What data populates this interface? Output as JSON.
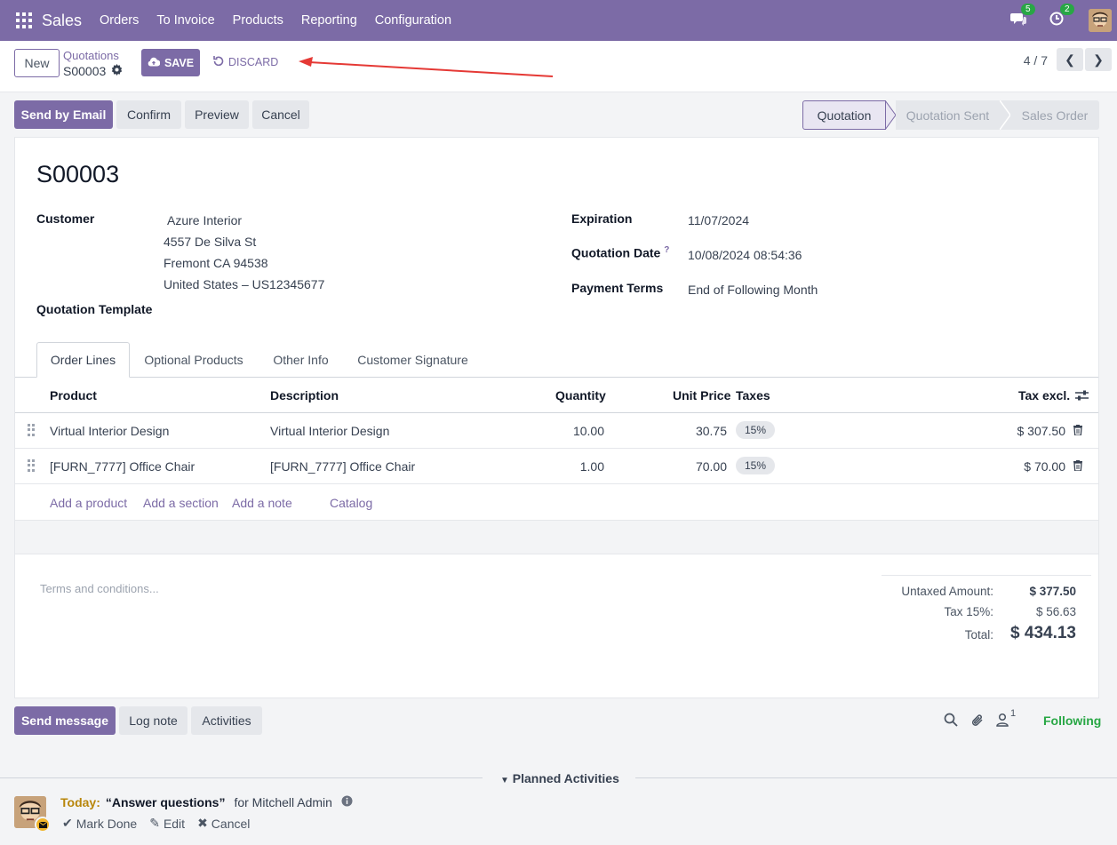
{
  "nav": {
    "app_name": "Sales",
    "menu": [
      "Orders",
      "To Invoice",
      "Products",
      "Reporting",
      "Configuration"
    ],
    "messages_count": "5",
    "activities_count": "2",
    "icons": [
      "apps-icon",
      "chat-icon",
      "clock-icon",
      "user-avatar"
    ]
  },
  "control": {
    "new_label": "New",
    "breadcrumb": "Quotations",
    "record": "S00003",
    "save_label": "SAVE",
    "discard_label": "DISCARD",
    "pager": "4 / 7"
  },
  "actions": {
    "send_email": "Send by Email",
    "confirm": "Confirm",
    "preview": "Preview",
    "cancel": "Cancel"
  },
  "status": {
    "stages": [
      "Quotation",
      "Quotation Sent",
      "Sales Order"
    ],
    "active": "Quotation"
  },
  "form": {
    "name": "S00003",
    "customer_label": "Customer",
    "customer_name": "Azure Interior",
    "address_line1": "4557 De Silva St",
    "address_line2": "Fremont CA 94538",
    "address_line3": "United States – US12345677",
    "template_label": "Quotation Template",
    "expiration_label": "Expiration",
    "expiration_value": "11/07/2024",
    "quotation_date_label": "Quotation Date",
    "quotation_date_value": "10/08/2024 08:54:36",
    "payment_terms_label": "Payment Terms",
    "payment_terms_value": "End of Following Month",
    "help_mark": "?"
  },
  "tabs": [
    "Order Lines",
    "Optional Products",
    "Other Info",
    "Customer Signature"
  ],
  "table": {
    "columns": [
      "Product",
      "Description",
      "Quantity",
      "Unit Price",
      "Taxes",
      "Tax excl."
    ],
    "rows": [
      {
        "product": "Virtual Interior Design",
        "description": "Virtual Interior Design",
        "quantity": "10.00",
        "unit_price": "30.75",
        "tax": "15%",
        "subtotal": "$ 307.50"
      },
      {
        "product": "[FURN_7777] Office Chair",
        "description": "[FURN_7777] Office Chair",
        "quantity": "1.00",
        "unit_price": "70.00",
        "tax": "15%",
        "subtotal": "$ 70.00"
      }
    ],
    "add_links": [
      "Add a product",
      "Add a section",
      "Add a note",
      "Catalog"
    ]
  },
  "footer": {
    "terms_placeholder": "Terms and conditions...",
    "untaxed_label": "Untaxed Amount:",
    "untaxed_value": "$ 377.50",
    "tax_label": "Tax 15%:",
    "tax_value": "$ 56.63",
    "total_label": "Total:",
    "total_value": "$ 434.13"
  },
  "chatter": {
    "send_message": "Send message",
    "log_note": "Log note",
    "activities": "Activities",
    "followers_count": "1",
    "following": "Following",
    "planned_title": "Planned Activities",
    "activity_when": "Today:",
    "activity_summary": "“Answer questions”",
    "activity_for": "for Mitchell Admin",
    "mark_done": "Mark Done",
    "edit": "Edit",
    "cancel": "Cancel"
  },
  "colors": {
    "brand": "#7c6ba6",
    "badge": "#28a745",
    "activity_today": "#b8860b",
    "annotation_arrow": "#e53935"
  }
}
